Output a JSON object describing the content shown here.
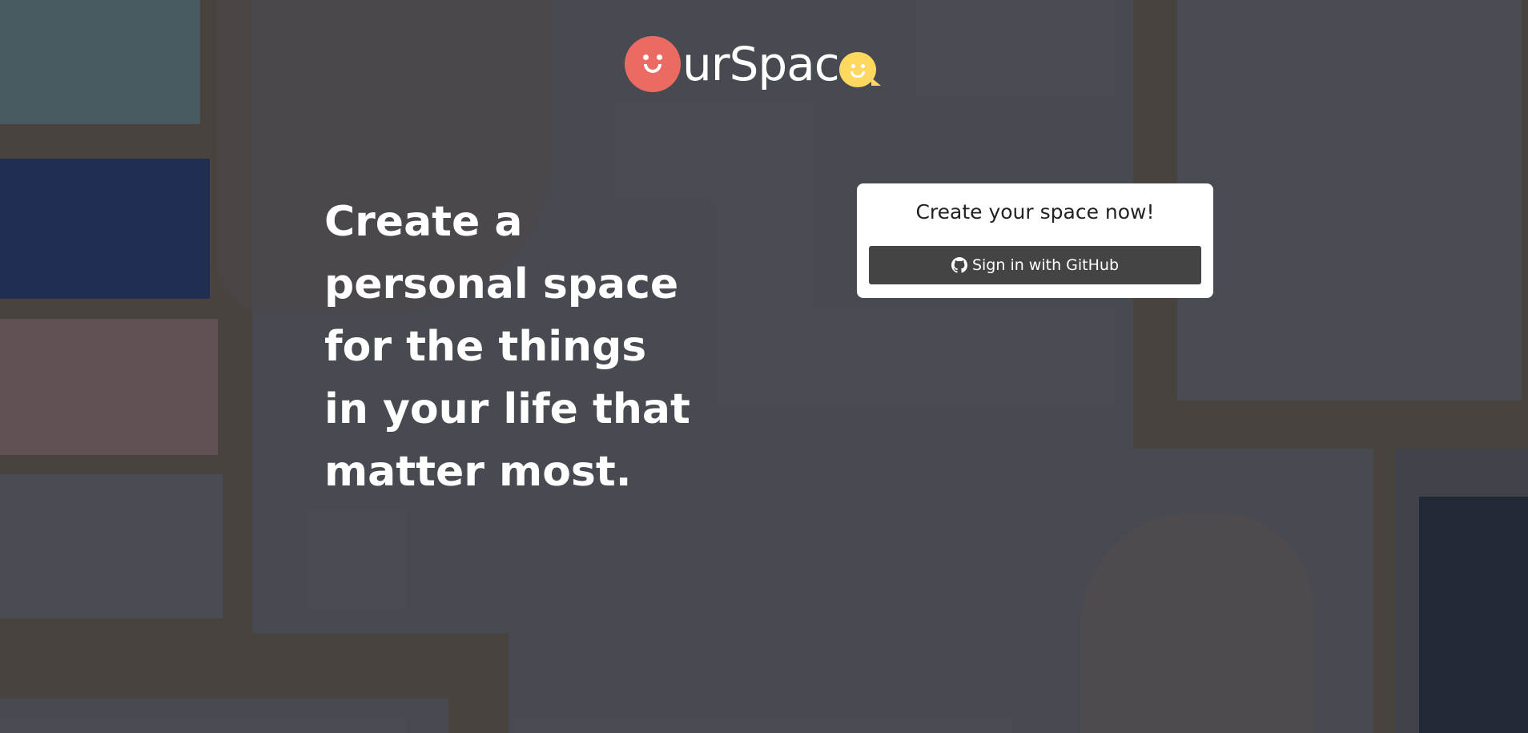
{
  "logo": {
    "text": "urSpac",
    "face_color": "#eb6b62",
    "bubble_color": "#ffd860"
  },
  "hero": {
    "tagline": "Create a personal space for the things in your life that matter most."
  },
  "signin": {
    "title": "Create your space now!",
    "github_button_label": "Sign in with GitHub",
    "github_icon": "github-icon",
    "button_color": "#444444"
  }
}
